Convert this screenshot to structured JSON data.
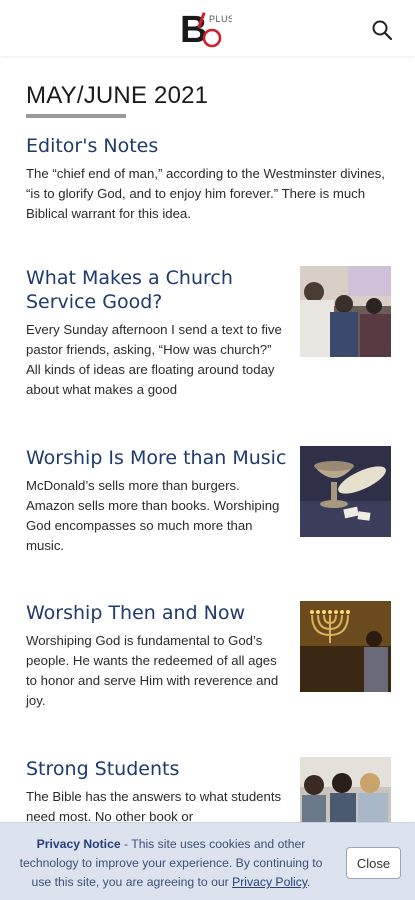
{
  "header": {
    "logo_letter": "B",
    "logo_plus": "PLUS",
    "logo_icon": "bo-plus-logo",
    "search_icon": "search-icon"
  },
  "issue": {
    "title": "MAY/JUNE 2021"
  },
  "articles": [
    {
      "title": "Editor's Notes",
      "excerpt": "The “chief end of man,” according to the Westminster divines, “is to glorify God, and to enjoy him forever.” There is much Biblical warrant for this idea."
    },
    {
      "title": "What Makes a Church Service Good?",
      "excerpt": "Every Sunday afternoon I send a text to five pastor friends, asking, “How was church?” All kinds of ideas are floating around today about what makes a good",
      "thumb_icon": "church-congregation-thumbnail"
    },
    {
      "title": "Worship Is More than Music",
      "excerpt": "McDonald’s sells more than burgers. Amazon sells more than books. Worshiping God encompasses so much more than music.",
      "thumb_icon": "communion-cup-thumbnail"
    },
    {
      "title": "Worship Then and Now",
      "excerpt": "Worshiping God is fundamental to God’s people. He wants the redeemed of all ages to honor and serve Him with reverence and joy.",
      "thumb_icon": "menorah-thumbnail"
    },
    {
      "title": "Strong Students",
      "excerpt": "The Bible has the answers to what students need most. No other book or",
      "thumb_icon": "students-studying-thumbnail"
    }
  ],
  "privacy": {
    "heading": "Privacy Notice",
    "body": " - This site uses cookies and other technology to improve your experience. By continuing to use this site, you are agreeing to our ",
    "link": "Privacy Policy",
    "end": ".",
    "close_label": "Close"
  },
  "colors": {
    "title_blue": "#1e3a6e",
    "logo_red": "#d0202e",
    "notice_bg": "#dde3ee"
  }
}
